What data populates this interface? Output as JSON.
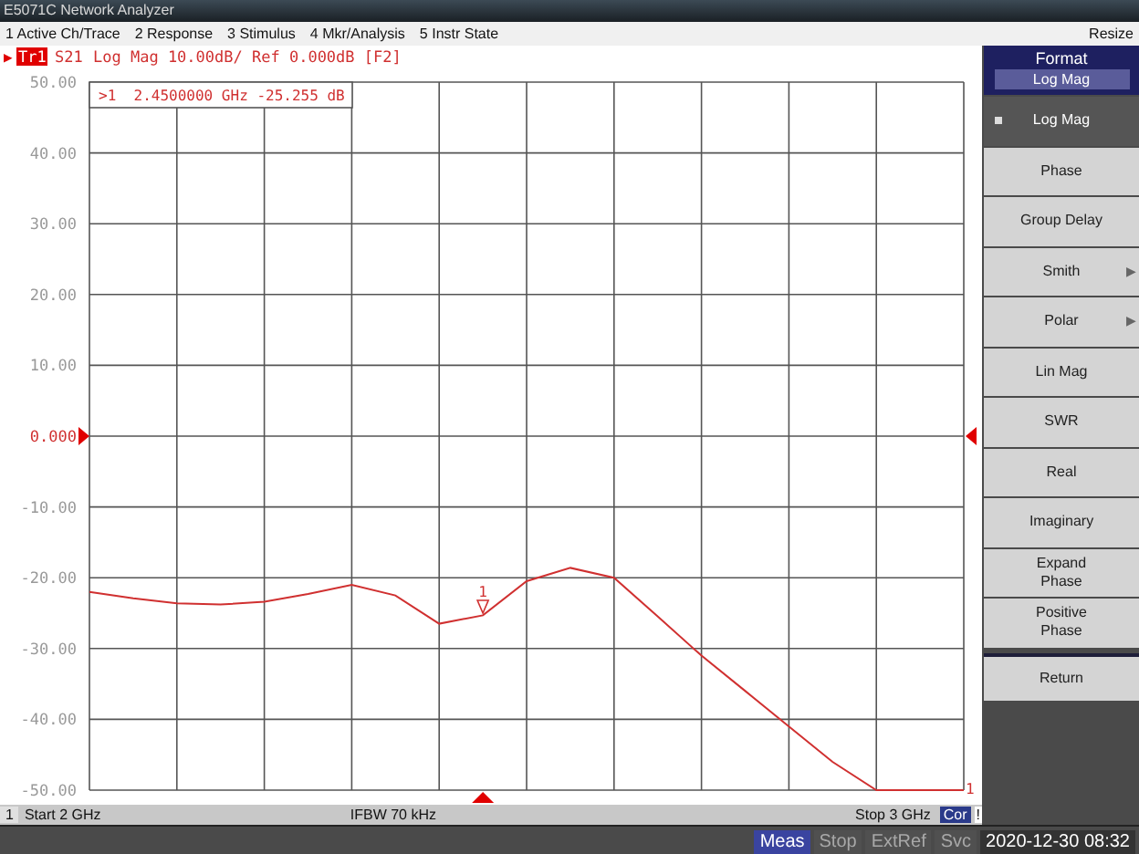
{
  "window": {
    "title": "E5071C Network Analyzer"
  },
  "menu": [
    {
      "label": "1 Active Ch/Trace"
    },
    {
      "label": "2 Response"
    },
    {
      "label": "3 Stimulus"
    },
    {
      "label": "4 Mkr/Analysis"
    },
    {
      "label": "5 Instr State"
    }
  ],
  "menu_right": "Resize",
  "trace_header": {
    "arrow": "▶",
    "trace": "Tr1",
    "text": "Log Mag 10.00dB/ Ref 0.000dB [F2]"
  },
  "marker_readout": ">1  2.4500000 GHz -25.255 dB",
  "edge_marker": "1",
  "chart_data": {
    "type": "line",
    "ylim": [
      -50,
      50
    ],
    "categories": [
      null,
      null,
      null,
      null,
      null,
      null,
      null,
      null,
      null,
      null,
      null,
      null,
      null,
      null,
      null,
      null,
      null,
      null,
      null,
      null,
      null
    ],
    "series": [
      {
        "name": "S21",
        "color": "#d03030",
        "values": [
          -22.0,
          -22.9,
          -23.6,
          -23.8,
          -23.4,
          -22.3,
          -21.0,
          -22.5,
          -26.5,
          -25.3,
          -20.5,
          -18.6,
          -20.0,
          -25.5,
          -31.0,
          -36.0,
          -41.0,
          -46.0,
          -50.0,
          -50.0,
          -50.0
        ]
      }
    ],
    "yticks": [
      {
        "value": 50,
        "label": "50.00"
      },
      {
        "value": 40,
        "label": "40.00"
      },
      {
        "value": 30,
        "label": "30.00"
      },
      {
        "value": 20,
        "label": "20.00"
      },
      {
        "value": 10,
        "label": "10.00"
      },
      {
        "value": 0,
        "label": "0.000"
      },
      {
        "value": -10,
        "label": "-10.00"
      },
      {
        "value": -20,
        "label": "-20.00"
      },
      {
        "value": -30,
        "label": "-30.00"
      },
      {
        "value": -40,
        "label": "-40.00"
      },
      {
        "value": -50,
        "label": "-50.00"
      }
    ],
    "grid": true,
    "annotations": [
      {
        "y": -25.255,
        "text": "1"
      }
    ]
  },
  "status": {
    "channel": "1",
    "start": "Start 2 GHz",
    "ifbw": "IFBW 70 kHz",
    "stop": "Stop 3 GHz",
    "correction": "Cor",
    "flag": "!"
  },
  "panel": {
    "title": "Format",
    "value": "Log Mag",
    "buttons": [
      {
        "label": "Log Mag",
        "selected": true,
        "submenu": false
      },
      {
        "label": "Phase",
        "selected": false,
        "submenu": false
      },
      {
        "label": "Group Delay",
        "selected": false,
        "submenu": false
      },
      {
        "label": "Smith",
        "selected": false,
        "submenu": true
      },
      {
        "label": "Polar",
        "selected": false,
        "submenu": true
      },
      {
        "label": "Lin Mag",
        "selected": false,
        "submenu": false
      },
      {
        "label": "SWR",
        "selected": false,
        "submenu": false
      },
      {
        "label": "Real",
        "selected": false,
        "submenu": false
      },
      {
        "label": "Imaginary",
        "selected": false,
        "submenu": false
      },
      {
        "label": "Expand\nPhase",
        "selected": false,
        "submenu": false
      },
      {
        "label": "Positive\nPhase",
        "selected": false,
        "submenu": false
      }
    ],
    "return": "Return"
  },
  "indicators": [
    {
      "label": "Meas",
      "on": true
    },
    {
      "label": "Stop",
      "on": false
    },
    {
      "label": "ExtRef",
      "on": false
    },
    {
      "label": "Svc",
      "on": false
    }
  ],
  "clock": "2020-12-30 08:32"
}
